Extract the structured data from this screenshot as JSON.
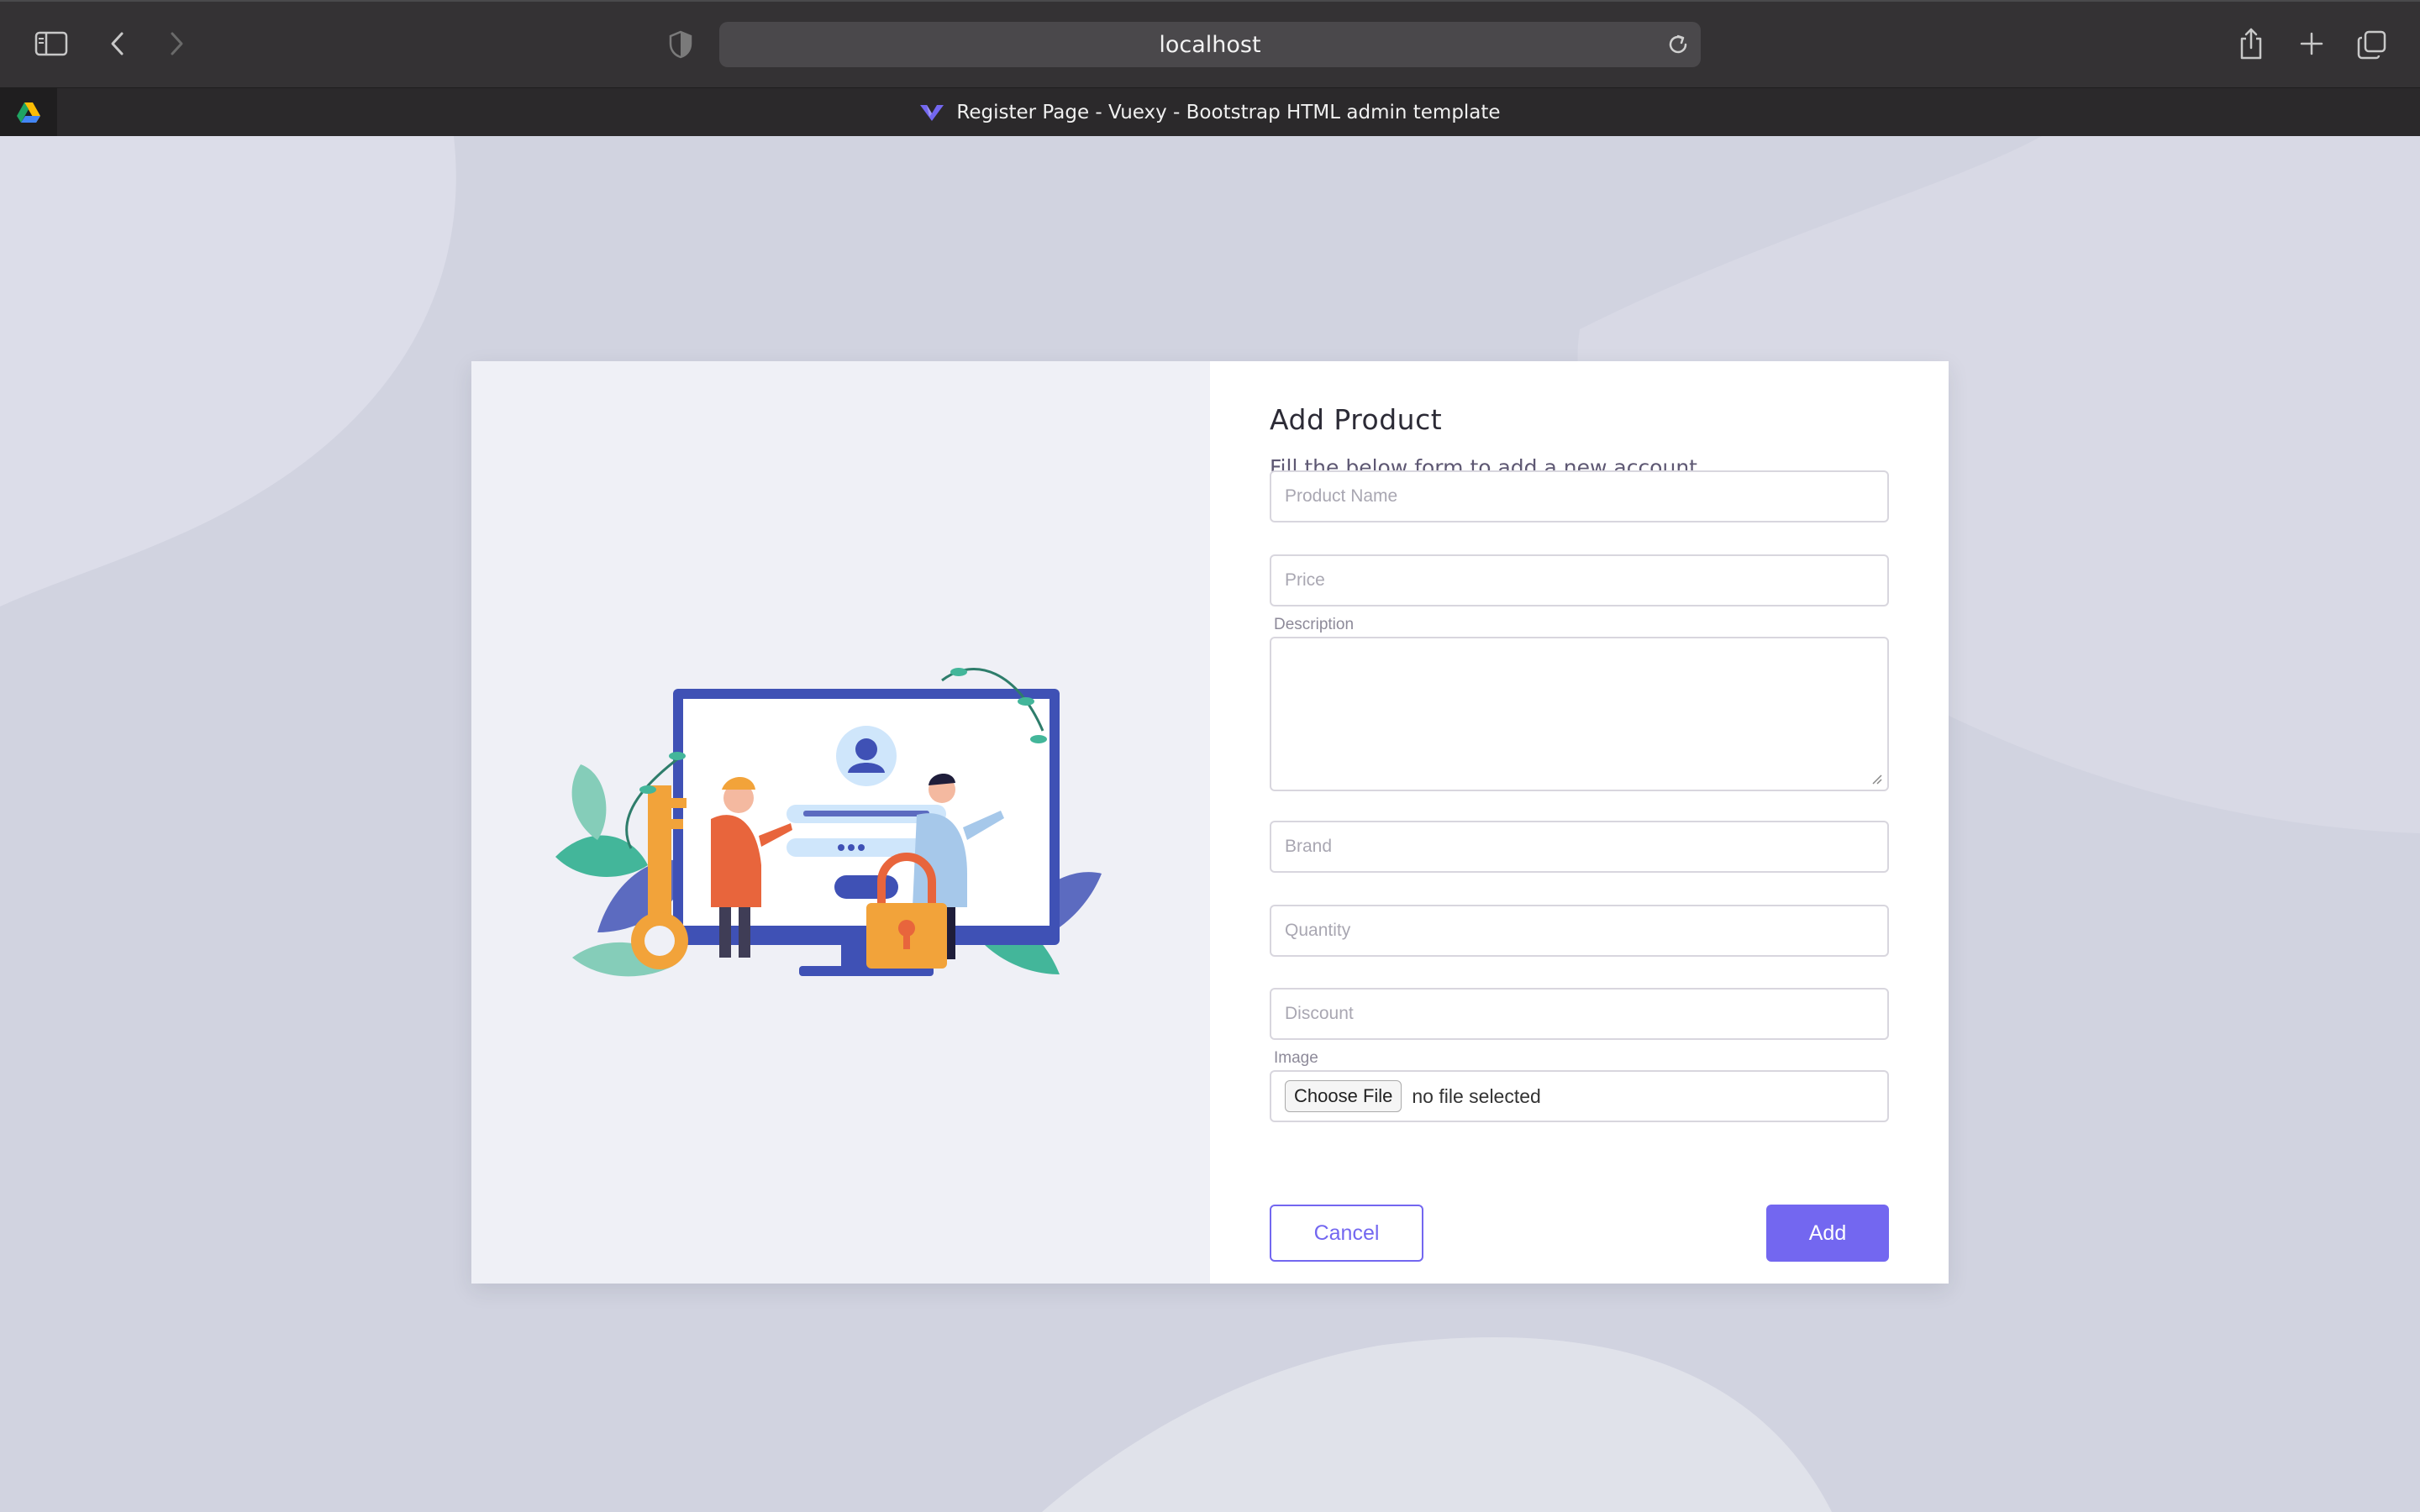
{
  "browser": {
    "url": "localhost",
    "tab_title": "Register Page - Vuexy - Bootstrap HTML admin template",
    "icons": [
      "sidebar-icon",
      "back-icon",
      "forward-icon",
      "shield-icon",
      "reload-icon",
      "share-icon",
      "new-tab-icon",
      "tab-overview-icon",
      "google-drive-icon",
      "vuexy-logo-icon"
    ]
  },
  "form": {
    "title": "Add Product",
    "subtitle": "Fill the below form to add a new account.",
    "product_name_placeholder": "Product Name",
    "price_placeholder": "Price",
    "description_label": "Description",
    "brand_placeholder": "Brand",
    "quantity_placeholder": "Quantity",
    "discount_placeholder": "Discount",
    "image_label": "Image",
    "choose_file_label": "Choose File",
    "file_status": "no file selected",
    "cancel_label": "Cancel",
    "add_label": "Add"
  },
  "colors": {
    "primary": "#7367f0",
    "page_background": "#d1d3e0",
    "illustration_panel": "#eff0f6"
  }
}
